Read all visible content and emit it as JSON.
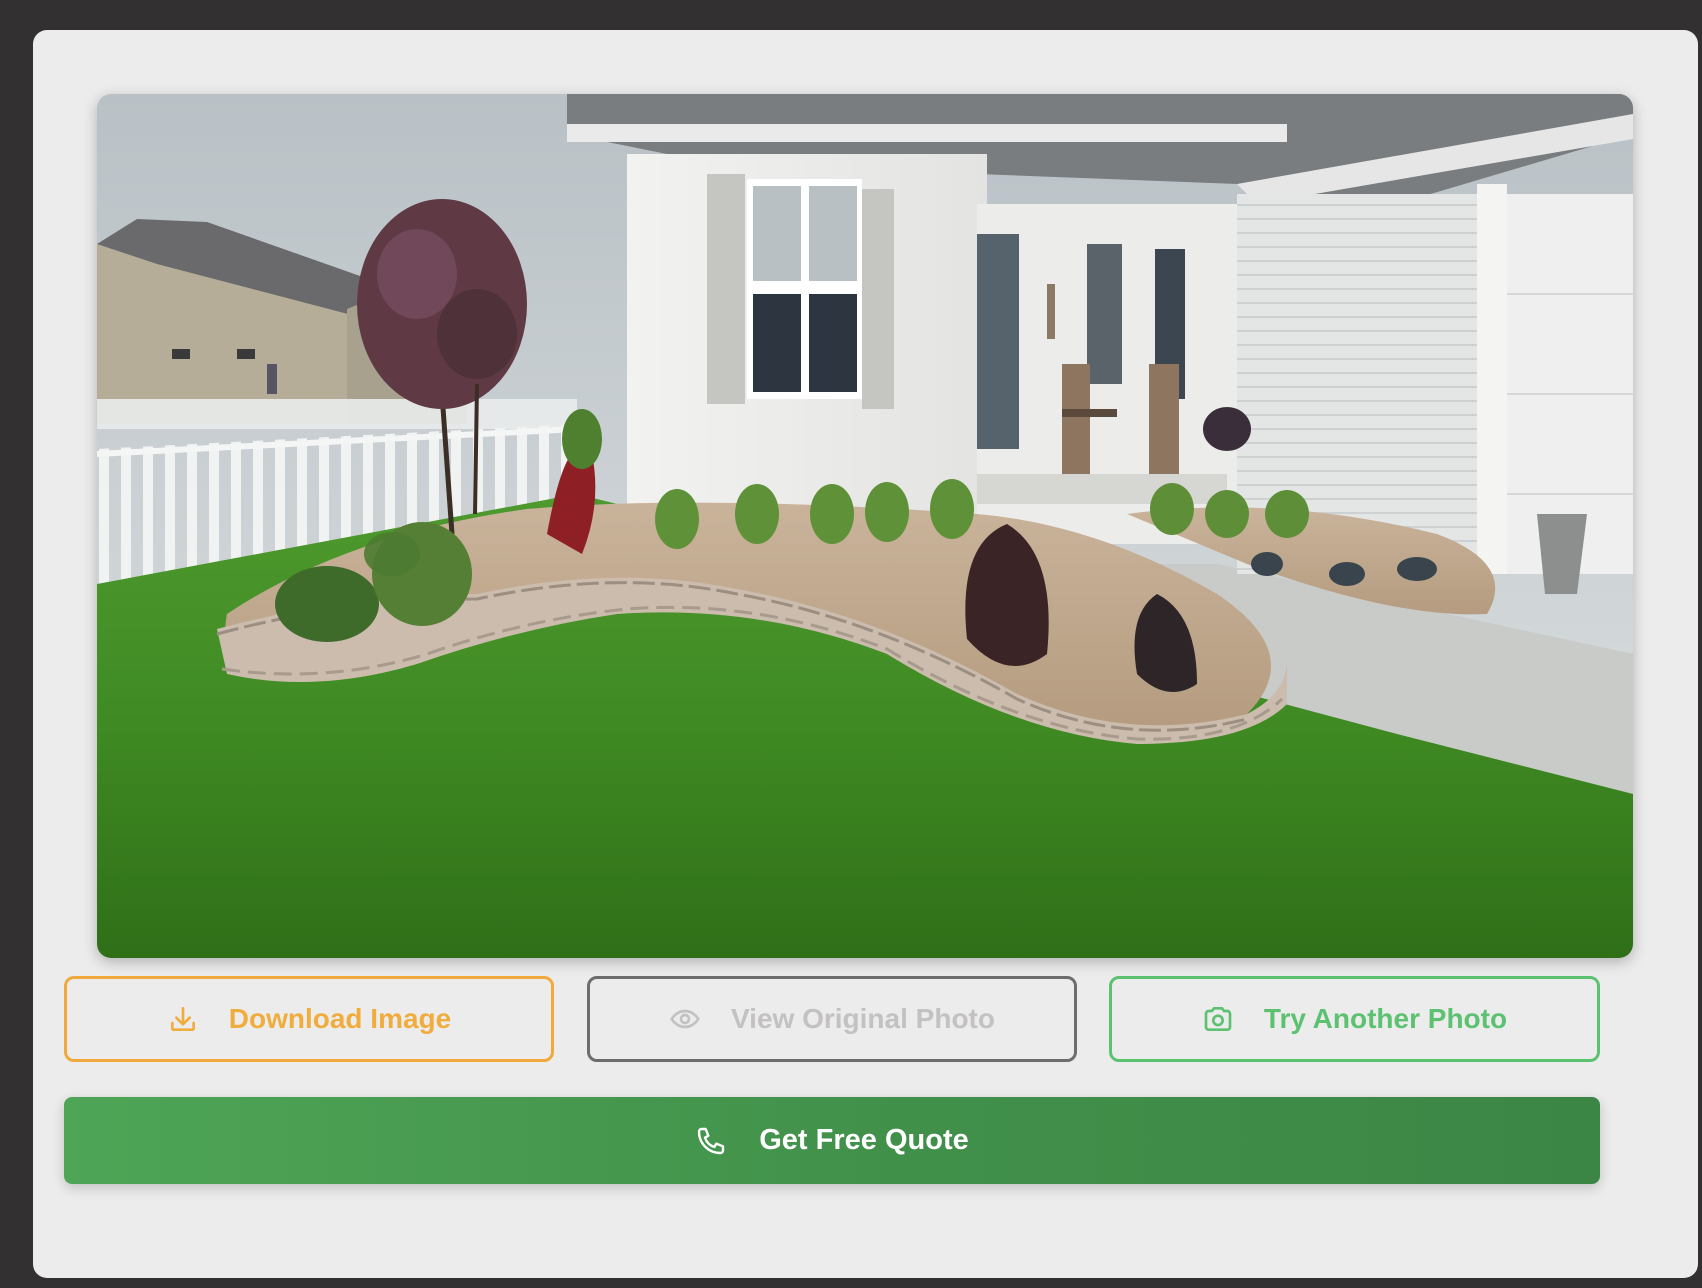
{
  "result_image": {
    "alt_icon": "landscaped-house-photo"
  },
  "actions": {
    "download_label": "Download Image",
    "view_original_label": "View Original Photo",
    "try_another_label": "Try Another Photo",
    "quote_label": "Get Free Quote"
  },
  "icons": {
    "download": "download-icon",
    "view": "eye-icon",
    "camera": "camera-icon",
    "phone": "phone-icon"
  },
  "colors": {
    "download_accent": "#f0a93a",
    "view_border": "#6f6c6c",
    "try_accent": "#5cc271",
    "quote_bg": "#41904a"
  }
}
